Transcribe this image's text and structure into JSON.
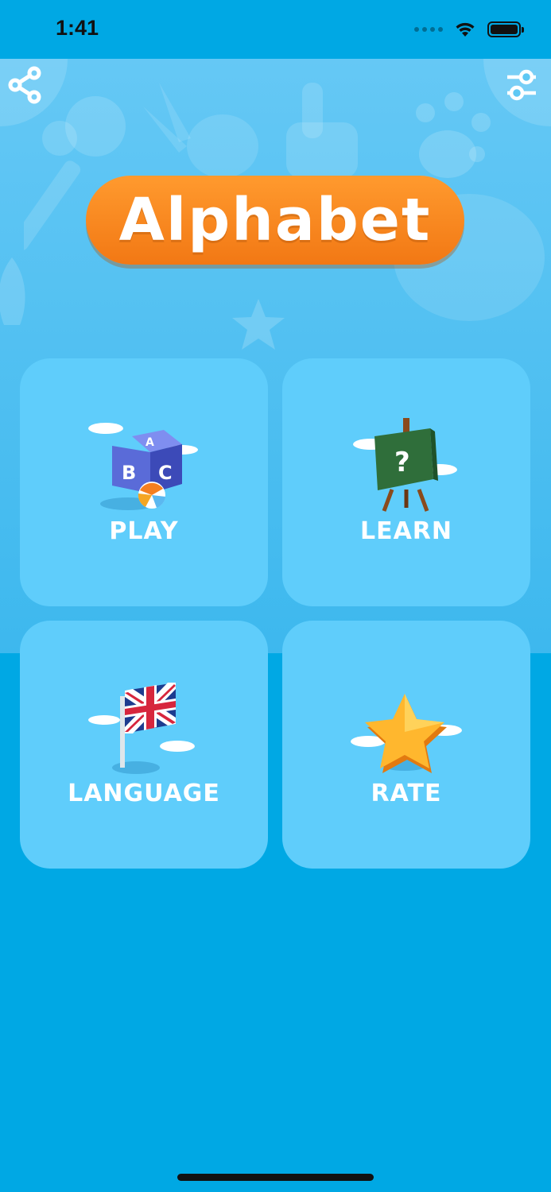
{
  "status_bar": {
    "time": "1:41",
    "battery_level": 1.0
  },
  "header": {
    "title": "Alphabet",
    "share_icon": "share-icon",
    "settings_icon": "sliders-icon"
  },
  "menu": {
    "tiles": [
      {
        "label": "PLAY",
        "icon": "abc-block-icon"
      },
      {
        "label": "LEARN",
        "icon": "question-board-icon"
      },
      {
        "label": "LANGUAGE",
        "icon": "uk-flag-icon"
      },
      {
        "label": "RATE",
        "icon": "star-icon"
      }
    ]
  },
  "colors": {
    "background": "#00a8e4",
    "hero": "#4fc0f2",
    "tile": "#5fcdfb",
    "title_pill": "#f7841c"
  }
}
